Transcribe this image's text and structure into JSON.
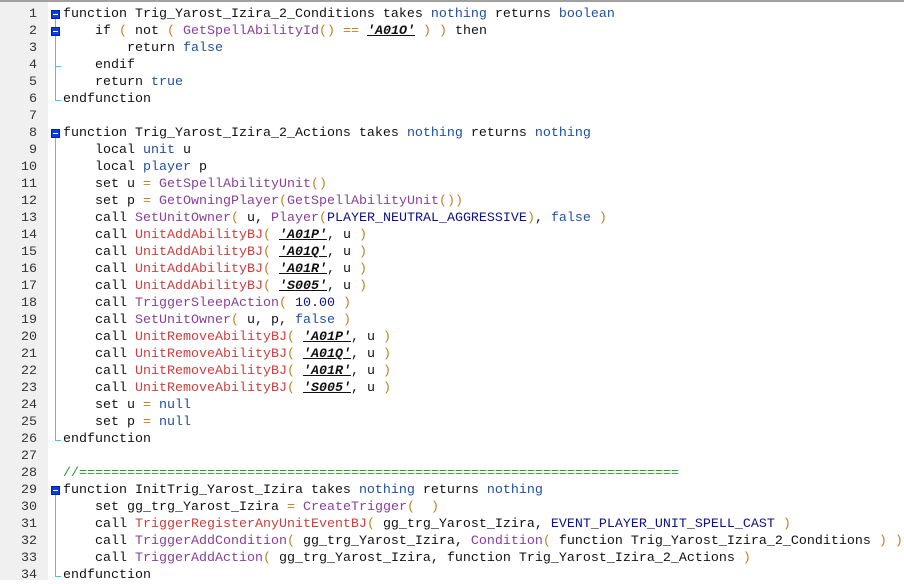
{
  "editor": {
    "lines": [
      {
        "n": "1",
        "t": [
          [
            "kw",
            "function Trig_Yarost_Izira_2_Conditions takes "
          ],
          [
            "ty",
            "nothing"
          ],
          [
            "kw",
            " returns "
          ],
          [
            "ty",
            "boolean"
          ]
        ]
      },
      {
        "n": "2",
        "t": [
          [
            "kw",
            "    if "
          ],
          [
            "op",
            "( "
          ],
          [
            "kw",
            "not "
          ],
          [
            "op",
            "( "
          ],
          [
            "nat",
            "GetSpellAbilityId"
          ],
          [
            "op",
            "() == "
          ],
          [
            "str",
            "'A01O'"
          ],
          [
            "op",
            " ) ) "
          ],
          [
            "kw",
            "then"
          ]
        ]
      },
      {
        "n": "3",
        "t": [
          [
            "kw",
            "        return "
          ],
          [
            "ty",
            "false"
          ]
        ]
      },
      {
        "n": "4",
        "t": [
          [
            "kw",
            "    endif"
          ]
        ]
      },
      {
        "n": "5",
        "t": [
          [
            "kw",
            "    return "
          ],
          [
            "ty",
            "true"
          ]
        ]
      },
      {
        "n": "6",
        "t": [
          [
            "kw",
            "endfunction"
          ]
        ]
      },
      {
        "n": "7",
        "t": []
      },
      {
        "n": "8",
        "t": [
          [
            "kw",
            "function Trig_Yarost_Izira_2_Actions takes "
          ],
          [
            "ty",
            "nothing"
          ],
          [
            "kw",
            " returns "
          ],
          [
            "ty",
            "nothing"
          ]
        ]
      },
      {
        "n": "9",
        "t": [
          [
            "kw",
            "    local "
          ],
          [
            "ty",
            "unit"
          ],
          [
            "pl",
            " u"
          ]
        ]
      },
      {
        "n": "10",
        "t": [
          [
            "kw",
            "    local "
          ],
          [
            "ty",
            "player"
          ],
          [
            "pl",
            " p"
          ]
        ]
      },
      {
        "n": "11",
        "t": [
          [
            "kw",
            "    set "
          ],
          [
            "pl",
            "u "
          ],
          [
            "op",
            "= "
          ],
          [
            "nat",
            "GetSpellAbilityUnit"
          ],
          [
            "op",
            "()"
          ]
        ]
      },
      {
        "n": "12",
        "t": [
          [
            "kw",
            "    set "
          ],
          [
            "pl",
            "p "
          ],
          [
            "op",
            "= "
          ],
          [
            "nat",
            "GetOwningPlayer"
          ],
          [
            "op",
            "("
          ],
          [
            "nat",
            "GetSpellAbilityUnit"
          ],
          [
            "op",
            "())"
          ]
        ]
      },
      {
        "n": "13",
        "t": [
          [
            "kw",
            "    call "
          ],
          [
            "nat",
            "SetUnitOwner"
          ],
          [
            "op",
            "( "
          ],
          [
            "pl",
            "u, "
          ],
          [
            "nat",
            "Player"
          ],
          [
            "op",
            "("
          ],
          [
            "cst",
            "PLAYER_NEUTRAL_AGGRESSIVE"
          ],
          [
            "op",
            ")"
          ],
          [
            "pl",
            ", "
          ],
          [
            "ty",
            "false"
          ],
          [
            "op",
            " )"
          ]
        ]
      },
      {
        "n": "14",
        "t": [
          [
            "kw",
            "    call "
          ],
          [
            "bj",
            "UnitAddAbilityBJ"
          ],
          [
            "op",
            "( "
          ],
          [
            "str",
            "'A01P'"
          ],
          [
            "pl",
            ", u "
          ],
          [
            "op",
            ")"
          ]
        ]
      },
      {
        "n": "15",
        "t": [
          [
            "kw",
            "    call "
          ],
          [
            "bj",
            "UnitAddAbilityBJ"
          ],
          [
            "op",
            "( "
          ],
          [
            "str",
            "'A01Q'"
          ],
          [
            "pl",
            ", u "
          ],
          [
            "op",
            ")"
          ]
        ]
      },
      {
        "n": "16",
        "t": [
          [
            "kw",
            "    call "
          ],
          [
            "bj",
            "UnitAddAbilityBJ"
          ],
          [
            "op",
            "( "
          ],
          [
            "str",
            "'A01R'"
          ],
          [
            "pl",
            ", u "
          ],
          [
            "op",
            ")"
          ]
        ]
      },
      {
        "n": "17",
        "t": [
          [
            "kw",
            "    call "
          ],
          [
            "bj",
            "UnitAddAbilityBJ"
          ],
          [
            "op",
            "( "
          ],
          [
            "str",
            "'S005'"
          ],
          [
            "pl",
            ", u "
          ],
          [
            "op",
            ")"
          ]
        ]
      },
      {
        "n": "18",
        "t": [
          [
            "kw",
            "    call "
          ],
          [
            "nat",
            "TriggerSleepAction"
          ],
          [
            "op",
            "( "
          ],
          [
            "num",
            "10.00"
          ],
          [
            "op",
            " )"
          ]
        ]
      },
      {
        "n": "19",
        "t": [
          [
            "kw",
            "    call "
          ],
          [
            "nat",
            "SetUnitOwner"
          ],
          [
            "op",
            "( "
          ],
          [
            "pl",
            "u, p, "
          ],
          [
            "ty",
            "false"
          ],
          [
            "op",
            " )"
          ]
        ]
      },
      {
        "n": "20",
        "t": [
          [
            "kw",
            "    call "
          ],
          [
            "bj",
            "UnitRemoveAbilityBJ"
          ],
          [
            "op",
            "( "
          ],
          [
            "str",
            "'A01P'"
          ],
          [
            "pl",
            ", u "
          ],
          [
            "op",
            ")"
          ]
        ]
      },
      {
        "n": "21",
        "t": [
          [
            "kw",
            "    call "
          ],
          [
            "bj",
            "UnitRemoveAbilityBJ"
          ],
          [
            "op",
            "( "
          ],
          [
            "str",
            "'A01Q'"
          ],
          [
            "pl",
            ", u "
          ],
          [
            "op",
            ")"
          ]
        ]
      },
      {
        "n": "22",
        "t": [
          [
            "kw",
            "    call "
          ],
          [
            "bj",
            "UnitRemoveAbilityBJ"
          ],
          [
            "op",
            "( "
          ],
          [
            "str",
            "'A01R'"
          ],
          [
            "pl",
            ", u "
          ],
          [
            "op",
            ")"
          ]
        ]
      },
      {
        "n": "23",
        "t": [
          [
            "kw",
            "    call "
          ],
          [
            "bj",
            "UnitRemoveAbilityBJ"
          ],
          [
            "op",
            "( "
          ],
          [
            "str",
            "'S005'"
          ],
          [
            "pl",
            ", u "
          ],
          [
            "op",
            ")"
          ]
        ]
      },
      {
        "n": "24",
        "t": [
          [
            "kw",
            "    set "
          ],
          [
            "pl",
            "u "
          ],
          [
            "op",
            "= "
          ],
          [
            "ty",
            "null"
          ]
        ]
      },
      {
        "n": "25",
        "t": [
          [
            "kw",
            "    set "
          ],
          [
            "pl",
            "p "
          ],
          [
            "op",
            "= "
          ],
          [
            "ty",
            "null"
          ]
        ]
      },
      {
        "n": "26",
        "t": [
          [
            "kw",
            "endfunction"
          ]
        ]
      },
      {
        "n": "27",
        "t": []
      },
      {
        "n": "28",
        "t": [
          [
            "cm",
            "//==========================================================================="
          ]
        ]
      },
      {
        "n": "29",
        "t": [
          [
            "kw",
            "function InitTrig_Yarost_Izira takes "
          ],
          [
            "ty",
            "nothing"
          ],
          [
            "kw",
            " returns "
          ],
          [
            "ty",
            "nothing"
          ]
        ]
      },
      {
        "n": "30",
        "t": [
          [
            "kw",
            "    set "
          ],
          [
            "pl",
            "gg_trg_Yarost_Izira "
          ],
          [
            "op",
            "= "
          ],
          [
            "nat",
            "CreateTrigger"
          ],
          [
            "op",
            "(  )"
          ]
        ]
      },
      {
        "n": "31",
        "t": [
          [
            "kw",
            "    call "
          ],
          [
            "bj",
            "TriggerRegisterAnyUnitEventBJ"
          ],
          [
            "op",
            "( "
          ],
          [
            "pl",
            "gg_trg_Yarost_Izira, "
          ],
          [
            "cst",
            "EVENT_PLAYER_UNIT_SPELL_CAST"
          ],
          [
            "op",
            " )"
          ]
        ]
      },
      {
        "n": "32",
        "t": [
          [
            "kw",
            "    call "
          ],
          [
            "nat",
            "TriggerAddCondition"
          ],
          [
            "op",
            "( "
          ],
          [
            "pl",
            "gg_trg_Yarost_Izira, "
          ],
          [
            "nat",
            "Condition"
          ],
          [
            "op",
            "( "
          ],
          [
            "kw",
            "function Trig_Yarost_Izira_2_Conditions "
          ],
          [
            "op",
            ") )"
          ]
        ]
      },
      {
        "n": "33",
        "t": [
          [
            "kw",
            "    call "
          ],
          [
            "nat",
            "TriggerAddAction"
          ],
          [
            "op",
            "( "
          ],
          [
            "pl",
            "gg_trg_Yarost_Izira, "
          ],
          [
            "kw",
            "function Trig_Yarost_Izira_2_Actions "
          ],
          [
            "op",
            ")"
          ]
        ]
      },
      {
        "n": "34",
        "t": [
          [
            "kw",
            "endfunction"
          ]
        ]
      }
    ]
  }
}
